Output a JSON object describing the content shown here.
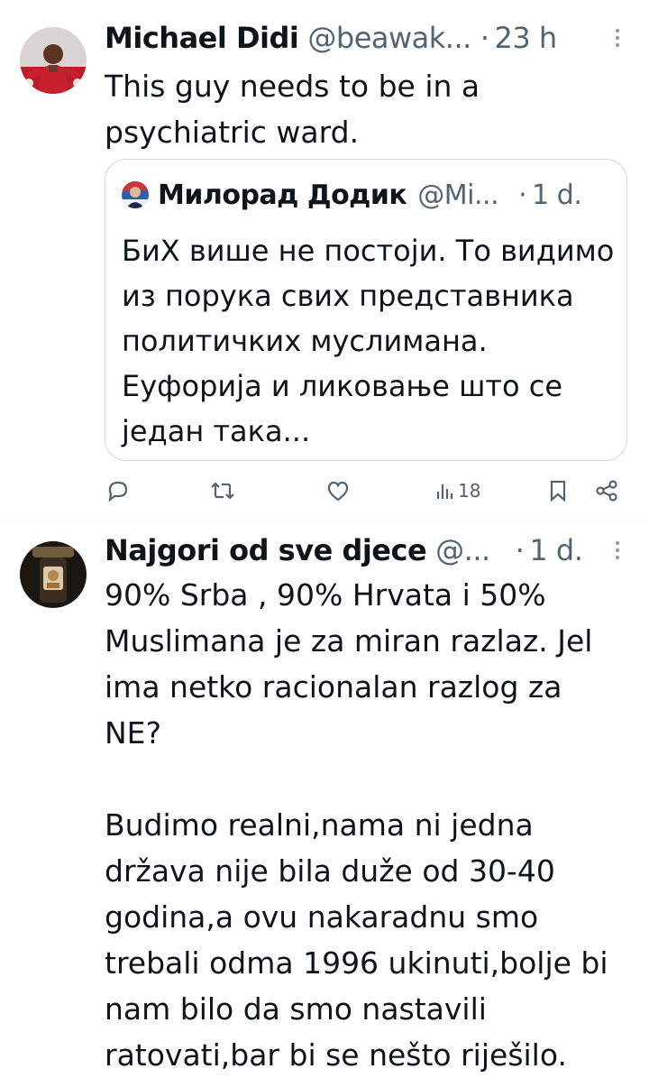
{
  "tweets": [
    {
      "author": {
        "name": "Michael Didi",
        "handle": "@beawak...",
        "avatar": "football-player-avatar"
      },
      "dot": "·",
      "time": "23 h",
      "text": "This guy needs to be in a\npsychiatric ward.",
      "quote": {
        "author": {
          "name": "Милорад Додик",
          "handle": "@Mi...",
          "avatar": "politician-avatar"
        },
        "dot": "·",
        "time": "1 d.",
        "text": "БиХ више не постоји. То видимо из порука свих представника политичких муслимана. Еуфорија и ликовање што се један така..."
      },
      "actions": {
        "reply_icon": "reply-icon",
        "retweet_icon": "retweet-icon",
        "like_icon": "heart-icon",
        "views_icon": "views-icon",
        "views": "18",
        "bookmark_icon": "bookmark-icon",
        "share_icon": "share-icon"
      }
    },
    {
      "author": {
        "name": "Najgori od sve djece",
        "handle": "@...",
        "avatar": "dark-photo-avatar"
      },
      "dot": "·",
      "time": "1 d.",
      "text": "90% Srba , 90% Hrvata i 50%\nMuslimana je za miran razlaz. Jel\nima netko racionalan razlog za\nNE?\n\nBudimo realni,nama ni jedna\ndržava nije bila duže od 30-40\ngodina,a ovu nakaradnu smo\ntrebali odma 1996 ukinuti,bolje bi\nnam bilo da smo nastavili\nratovati,bar bi se nešto riješilo."
    }
  ],
  "colors": {
    "text": "#0f1419",
    "secondary": "#536471",
    "border": "#cfd9de",
    "divider": "#eff3f4"
  }
}
